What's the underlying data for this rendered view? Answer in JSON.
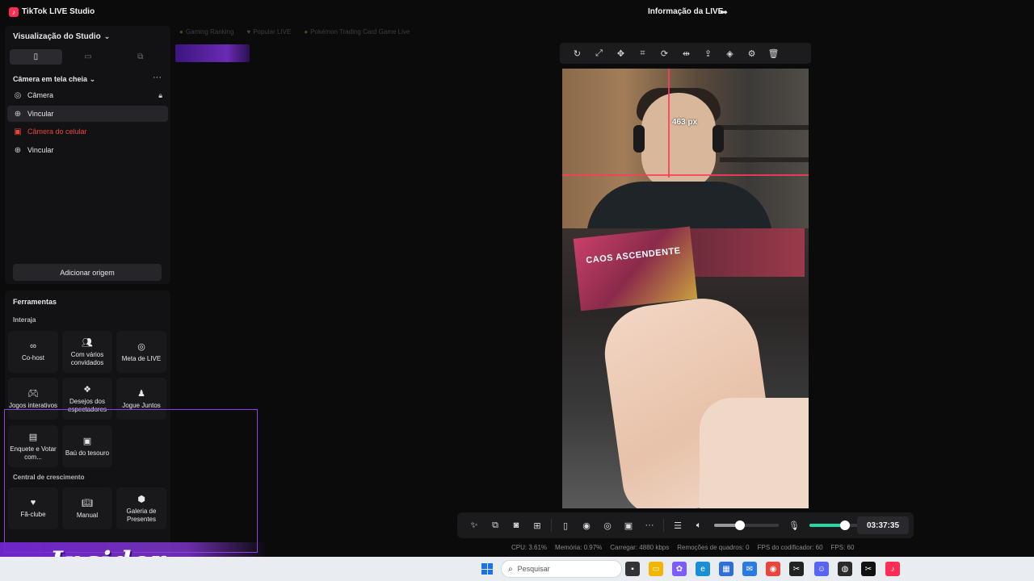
{
  "titlebar": {
    "app_title": "TikTok LIVE Studio",
    "live_info": "Informação da LIVE"
  },
  "studio": {
    "title": "Visualização do Studio",
    "scene": "Câmera em tela cheia",
    "sources": [
      {
        "label": "Câmera",
        "icon": "camera-icon",
        "locked": true
      },
      {
        "label": "Vincular",
        "icon": "globe-icon",
        "selected": true
      },
      {
        "label": "Câmera do celular",
        "icon": "phone-camera-icon",
        "warning": true
      },
      {
        "label": "Vincular",
        "icon": "globe-icon"
      }
    ],
    "add_source": "Adicionar origem"
  },
  "tools": {
    "title": "Ferramentas",
    "sections": [
      {
        "label": "Interaja",
        "items": [
          {
            "label": "Co-host",
            "icon": "link-icon"
          },
          {
            "label": "Com vários convidados",
            "icon": "users-icon"
          },
          {
            "label": "Meta de LIVE",
            "icon": "target-icon"
          },
          {
            "label": "Jogos interativos",
            "icon": "gamepad-icon"
          },
          {
            "label": "Desejos dos espectadores",
            "icon": "gift-grid-icon"
          },
          {
            "label": "Jogue Juntos",
            "icon": "person-icon"
          },
          {
            "label": "Enquete e Votar com...",
            "icon": "poll-icon"
          },
          {
            "label": "Baú do tesouro",
            "icon": "chest-icon"
          }
        ]
      },
      {
        "label": "Central de crescimento",
        "items": [
          {
            "label": "Fã-clube",
            "icon": "heart-icon"
          },
          {
            "label": "Manual",
            "icon": "book-icon"
          },
          {
            "label": "Galeria de Presentes",
            "icon": "gift-icon"
          }
        ]
      }
    ]
  },
  "rankings": [
    "Gaming Ranking",
    "Popular LIVE",
    "Pokémon Trading Card Game Live"
  ],
  "preview": {
    "guide_label": "463 px",
    "pack_text": "CAOS ASCENDENTE"
  },
  "controls": {
    "timer": "03:37:35",
    "volume_level": 0.4,
    "mic_level": 0.55
  },
  "stats": {
    "cpu": "CPU: 3.61%",
    "memory": "Memória: 0.97%",
    "upload": "Carregar: 4880 kbps",
    "dropped": "Remoções de quadros: 0",
    "encoder_fps": "FPS do codificador: 60",
    "fps": "FPS: 60"
  },
  "taskbar": {
    "search_placeholder": "Pesquisar"
  },
  "watermark": {
    "text": "Insider"
  },
  "colors": {
    "accent": "#ff2d55",
    "warning": "#e8453c",
    "mic_green": "#25d9a8",
    "overlay_purple": "#8b3df0"
  }
}
